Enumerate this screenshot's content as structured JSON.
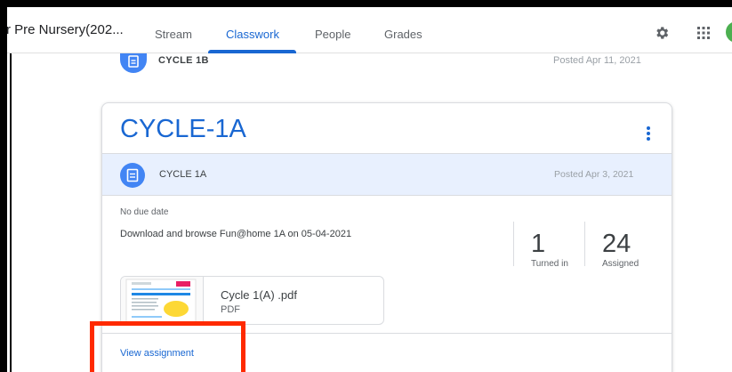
{
  "header": {
    "class_title": "r Pre Nursery(202...",
    "tabs": [
      {
        "label": "Stream"
      },
      {
        "label": "Classwork"
      },
      {
        "label": "People"
      },
      {
        "label": "Grades"
      }
    ],
    "active_tab": "Classwork",
    "settings_icon": "gear-icon",
    "apps_icon": "apps-grid-icon"
  },
  "previous_item": {
    "title": "CYCLE 1B",
    "posted": "Posted Apr 11, 2021",
    "icon": "assignment-icon"
  },
  "topic": {
    "title": "CYCLE-1A",
    "menu_icon": "more-vert-icon"
  },
  "assignment": {
    "title": "CYCLE 1A",
    "posted": "Posted Apr 3, 2021",
    "icon": "assignment-icon",
    "due": "No due date",
    "description": "Download and browse Fun@home 1A on 05-04-2021",
    "turned_in": {
      "value": "1",
      "label": "Turned in"
    },
    "assigned": {
      "value": "24",
      "label": "Assigned"
    },
    "attachment": {
      "name": "Cycle 1(A) .pdf",
      "type": "PDF"
    },
    "view_link": "View assignment"
  },
  "colors": {
    "accent": "#1967d2",
    "icon_blue": "#4285f4",
    "header_tint": "#e8f0fe",
    "highlight": "#ff2a00"
  }
}
